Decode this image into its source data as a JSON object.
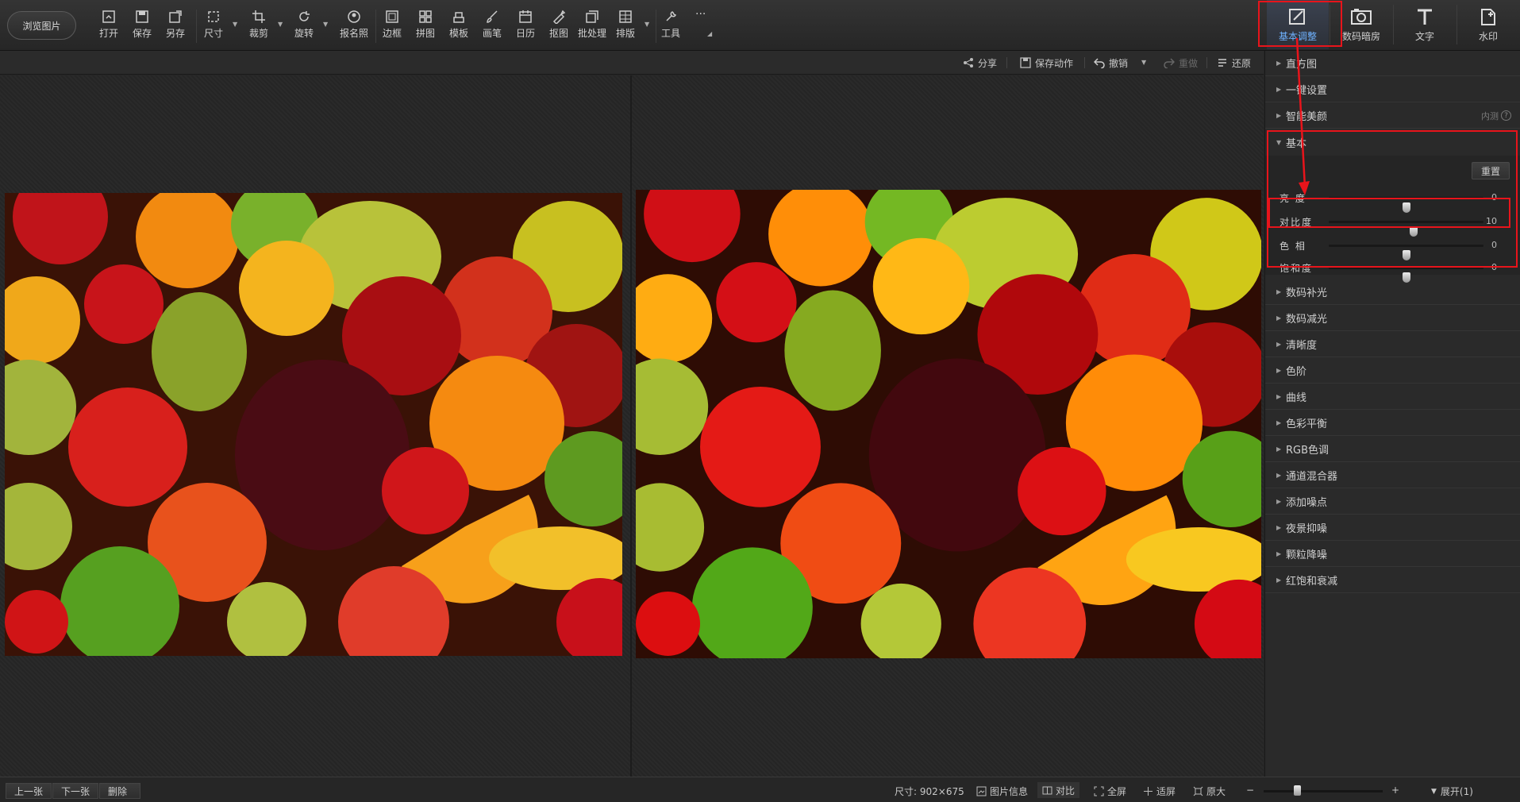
{
  "toolbar": {
    "browse_label": "浏览图片",
    "tools": [
      {
        "label": "打开",
        "icon": "open-icon"
      },
      {
        "label": "保存",
        "icon": "save-icon"
      },
      {
        "label": "另存",
        "icon": "save-as-icon"
      },
      {
        "label": "尺寸",
        "icon": "resize-icon"
      },
      {
        "label": "裁剪",
        "icon": "crop-icon"
      },
      {
        "label": "旋转",
        "icon": "rotate-icon"
      },
      {
        "label": "报名照",
        "icon": "id-photo-icon"
      },
      {
        "label": "边框",
        "icon": "border-icon"
      },
      {
        "label": "拼图",
        "icon": "collage-icon"
      },
      {
        "label": "模板",
        "icon": "template-icon"
      },
      {
        "label": "画笔",
        "icon": "brush-icon"
      },
      {
        "label": "日历",
        "icon": "calendar-icon"
      },
      {
        "label": "抠图",
        "icon": "cutout-icon"
      },
      {
        "label": "批处理",
        "icon": "batch-icon"
      },
      {
        "label": "排版",
        "icon": "layout-icon"
      },
      {
        "label": "工具",
        "icon": "tools-icon"
      }
    ],
    "more_label": "···"
  },
  "panel_tabs": [
    {
      "label": "基本调整",
      "icon": "adjust-icon",
      "active": true
    },
    {
      "label": "数码暗房",
      "icon": "camera-icon",
      "active": false
    },
    {
      "label": "文字",
      "icon": "text-icon",
      "active": false
    },
    {
      "label": "水印",
      "icon": "watermark-icon",
      "active": false
    }
  ],
  "actions": {
    "share": "分享",
    "save_action": "保存动作",
    "undo": "撤销",
    "redo": "重做",
    "restore": "还原"
  },
  "panel": {
    "sections_top": [
      {
        "label": "直方图"
      },
      {
        "label": "一键设置"
      },
      {
        "label": "智能美颜",
        "extra": "内测",
        "help": "?"
      }
    ],
    "basic": {
      "title": "基本",
      "reset": "重置",
      "sliders": [
        {
          "label": "亮 度",
          "value": "0",
          "pos": 0.5
        },
        {
          "label": "对比度",
          "value": "10",
          "pos": 0.55
        },
        {
          "label": "色 相",
          "value": "0",
          "pos": 0.5
        },
        {
          "label": "饱和度",
          "value": "0",
          "pos": 0.5
        }
      ]
    },
    "sections_bottom": [
      {
        "label": "数码补光"
      },
      {
        "label": "数码减光"
      },
      {
        "label": "清晰度"
      },
      {
        "label": "色阶"
      },
      {
        "label": "曲线"
      },
      {
        "label": "色彩平衡"
      },
      {
        "label": "RGB色调"
      },
      {
        "label": "通道混合器"
      },
      {
        "label": "添加噪点"
      },
      {
        "label": "夜景抑噪"
      },
      {
        "label": "颗粒降噪"
      },
      {
        "label": "红饱和衰减"
      }
    ]
  },
  "status": {
    "prev": "上一张",
    "next": "下一张",
    "delete": "删除",
    "size_label": "尺寸: 902×675",
    "info": "图片信息",
    "compare": "对比",
    "fullscreen": "全屏",
    "fit": "适屏",
    "actual": "原大",
    "zoom_minus": "−",
    "zoom_plus": "+",
    "expand": "展开(1)"
  },
  "colors": {
    "accent": "#6fb2ff",
    "highlight": "#e8141b",
    "panel_bg": "#2a2a2a"
  }
}
